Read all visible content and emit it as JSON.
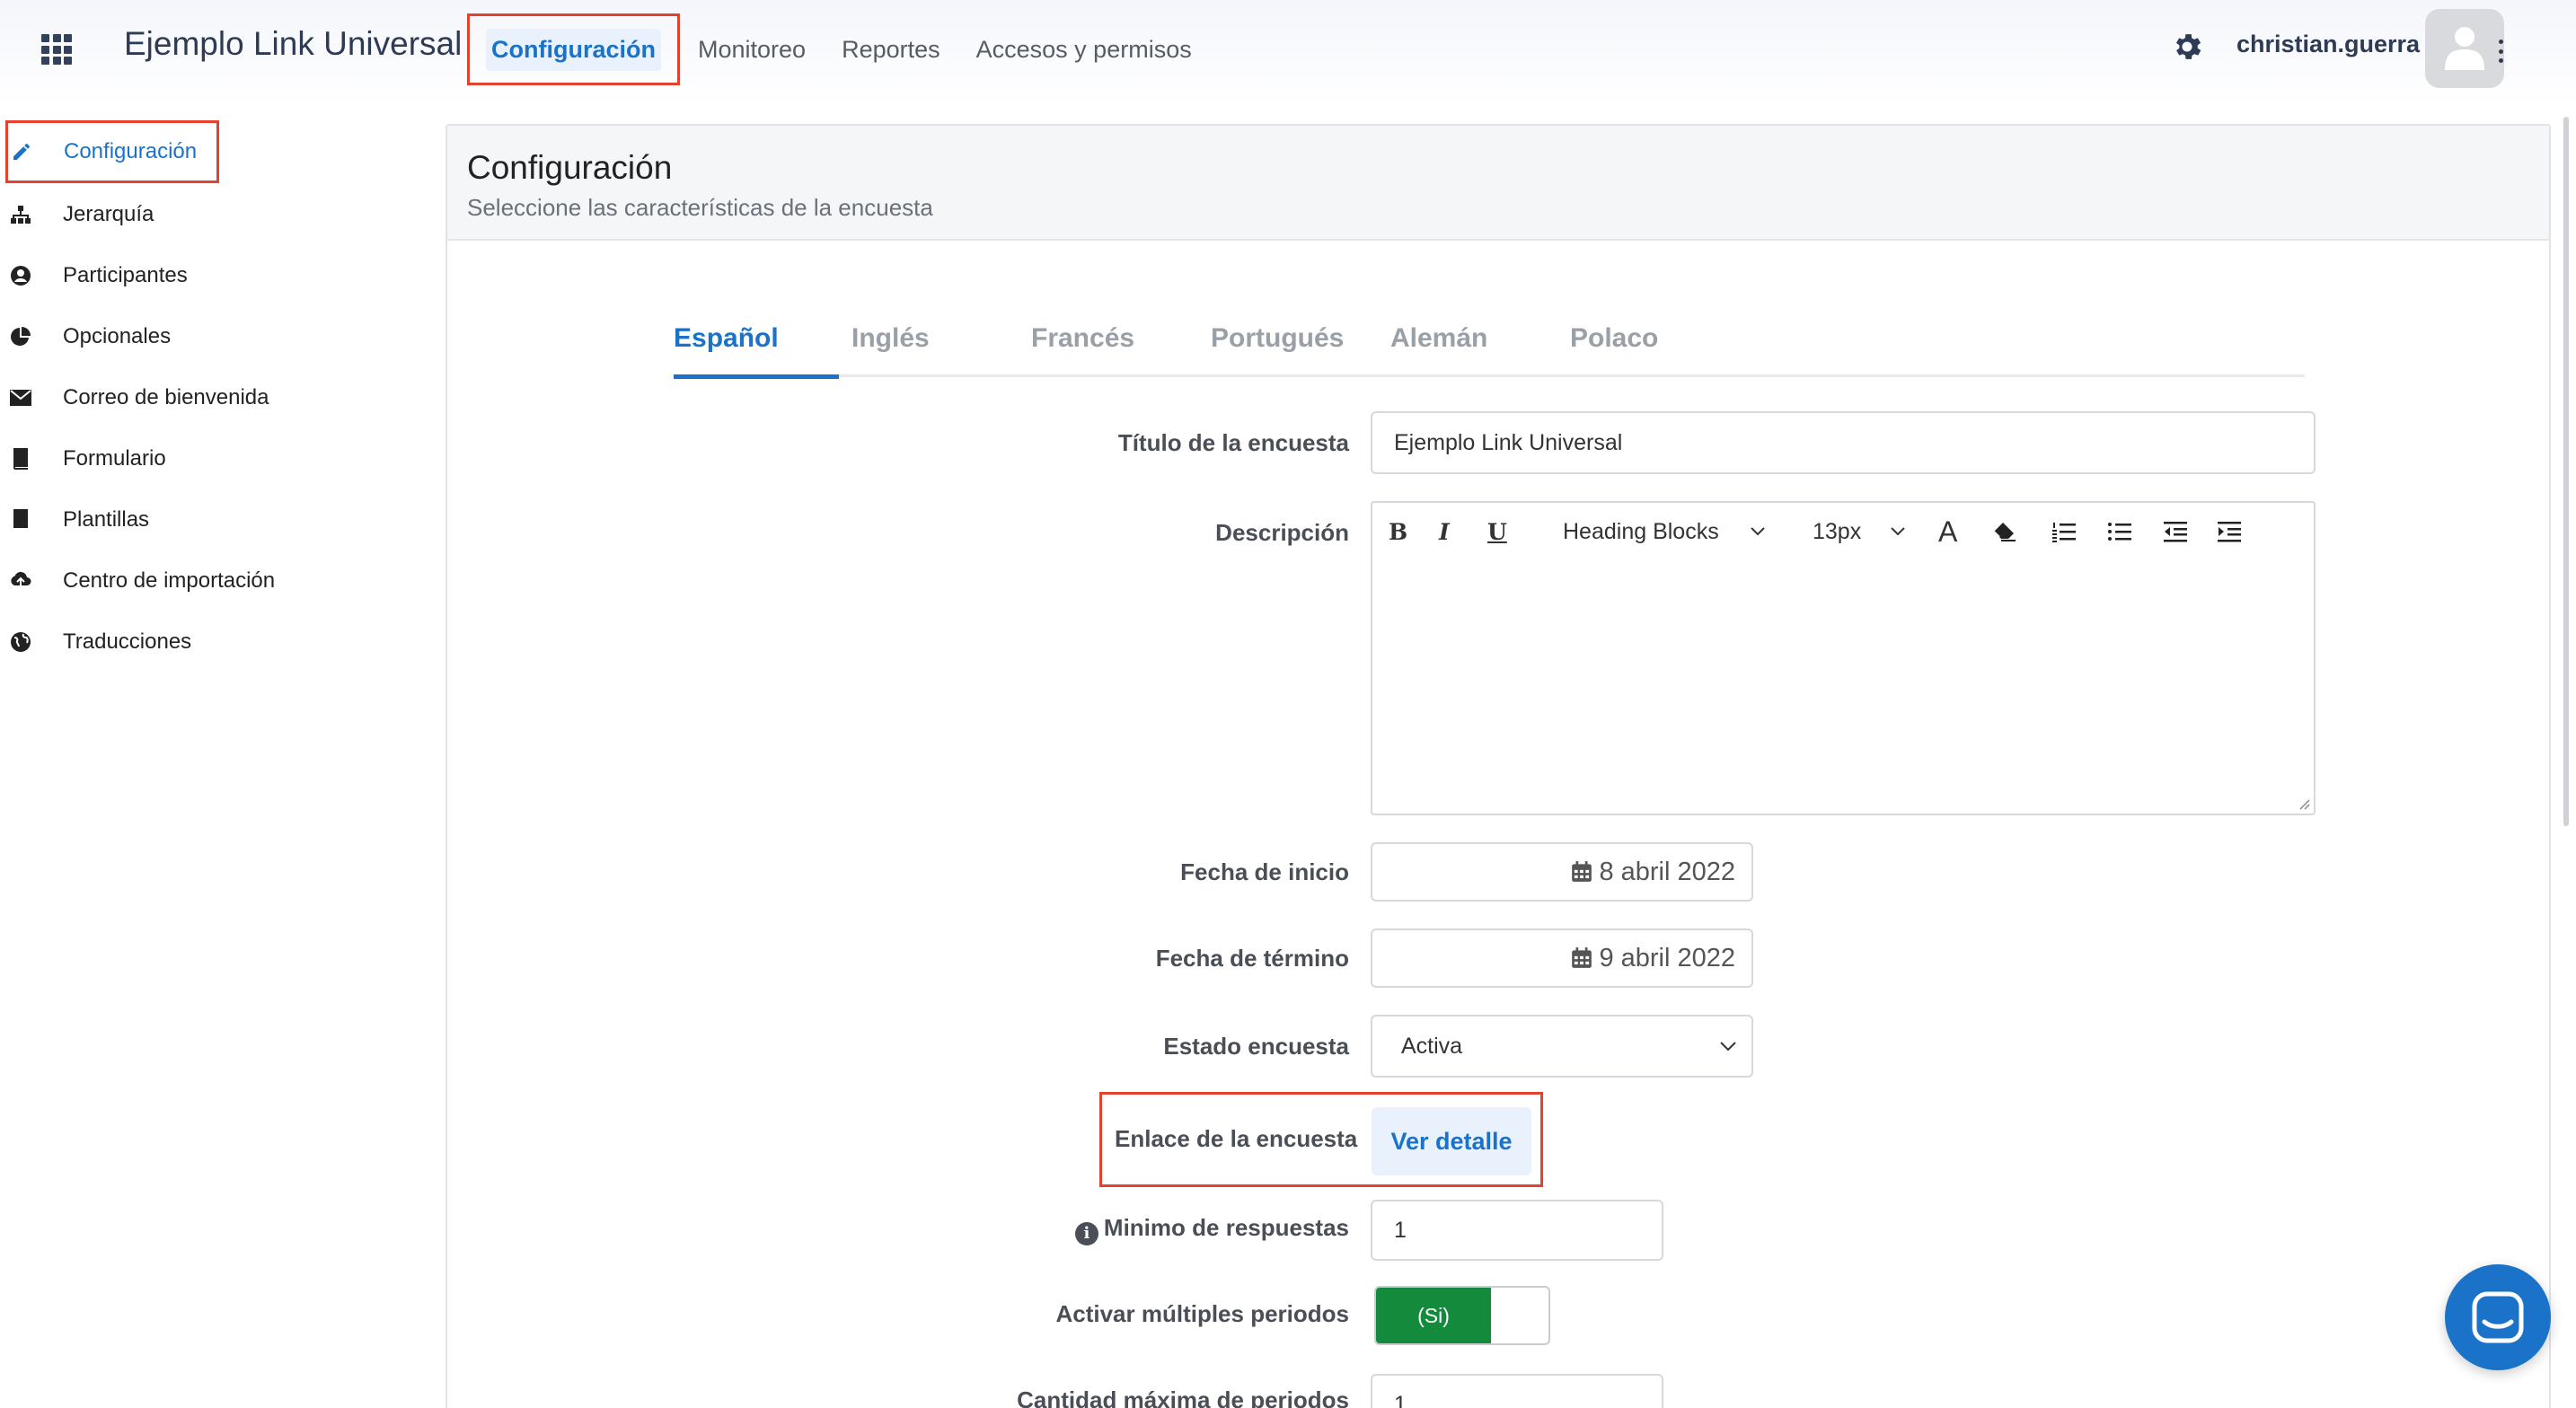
{
  "header": {
    "app_title": "Ejemplo Link Universal",
    "nav": [
      {
        "label": "Configuración",
        "active": true
      },
      {
        "label": "Monitoreo"
      },
      {
        "label": "Reportes"
      },
      {
        "label": "Accesos y permisos"
      }
    ],
    "username": "christian.guerra",
    "icons": [
      "apps-grid-icon",
      "gear-icon",
      "avatar-icon",
      "kebab-icon"
    ]
  },
  "sidebar": {
    "items": [
      {
        "label": "Configuración",
        "icon": "pencil-icon",
        "active": true
      },
      {
        "label": "Jerarquía",
        "icon": "hierarchy-icon"
      },
      {
        "label": "Participantes",
        "icon": "user-icon"
      },
      {
        "label": "Opcionales",
        "icon": "pie-chart-icon"
      },
      {
        "label": "Correo de bienvenida",
        "icon": "envelope-icon"
      },
      {
        "label": "Formulario",
        "icon": "book-icon"
      },
      {
        "label": "Plantillas",
        "icon": "book-icon"
      },
      {
        "label": "Centro de importación",
        "icon": "cloud-upload-icon"
      },
      {
        "label": "Traducciones",
        "icon": "globe-icon"
      }
    ]
  },
  "panel": {
    "title": "Configuración",
    "subtitle": "Seleccione las características de la encuesta"
  },
  "tabs": [
    {
      "label": "Español",
      "active": true
    },
    {
      "label": "Inglés"
    },
    {
      "label": "Francés"
    },
    {
      "label": "Portugués"
    },
    {
      "label": "Alemán"
    },
    {
      "label": "Polaco"
    }
  ],
  "form": {
    "title_label": "Título de la encuesta",
    "title_value": "Ejemplo Link Universal",
    "description_label": "Descripción",
    "editor": {
      "heading_select": "Heading Blocks",
      "size_select": "13px",
      "font_color": "A"
    },
    "start_label": "Fecha de inicio",
    "start_value": "8 abril 2022",
    "end_label": "Fecha de término",
    "end_value": "9 abril 2022",
    "status_label": "Estado encuesta",
    "status_value": "Activa",
    "link_label": "Enlace de la encuesta",
    "link_button": "Ver detalle",
    "min_label": "Minimo de respuestas",
    "min_value": "1",
    "multi_label": "Activar múltiples periodos",
    "multi_toggle": "(Si)",
    "max_label": "Cantidad máxima de periodos",
    "max_value": "1"
  },
  "colors": {
    "accent": "#1a73c8",
    "highlight": "#e5412f",
    "toggle_on": "#148a3c"
  }
}
